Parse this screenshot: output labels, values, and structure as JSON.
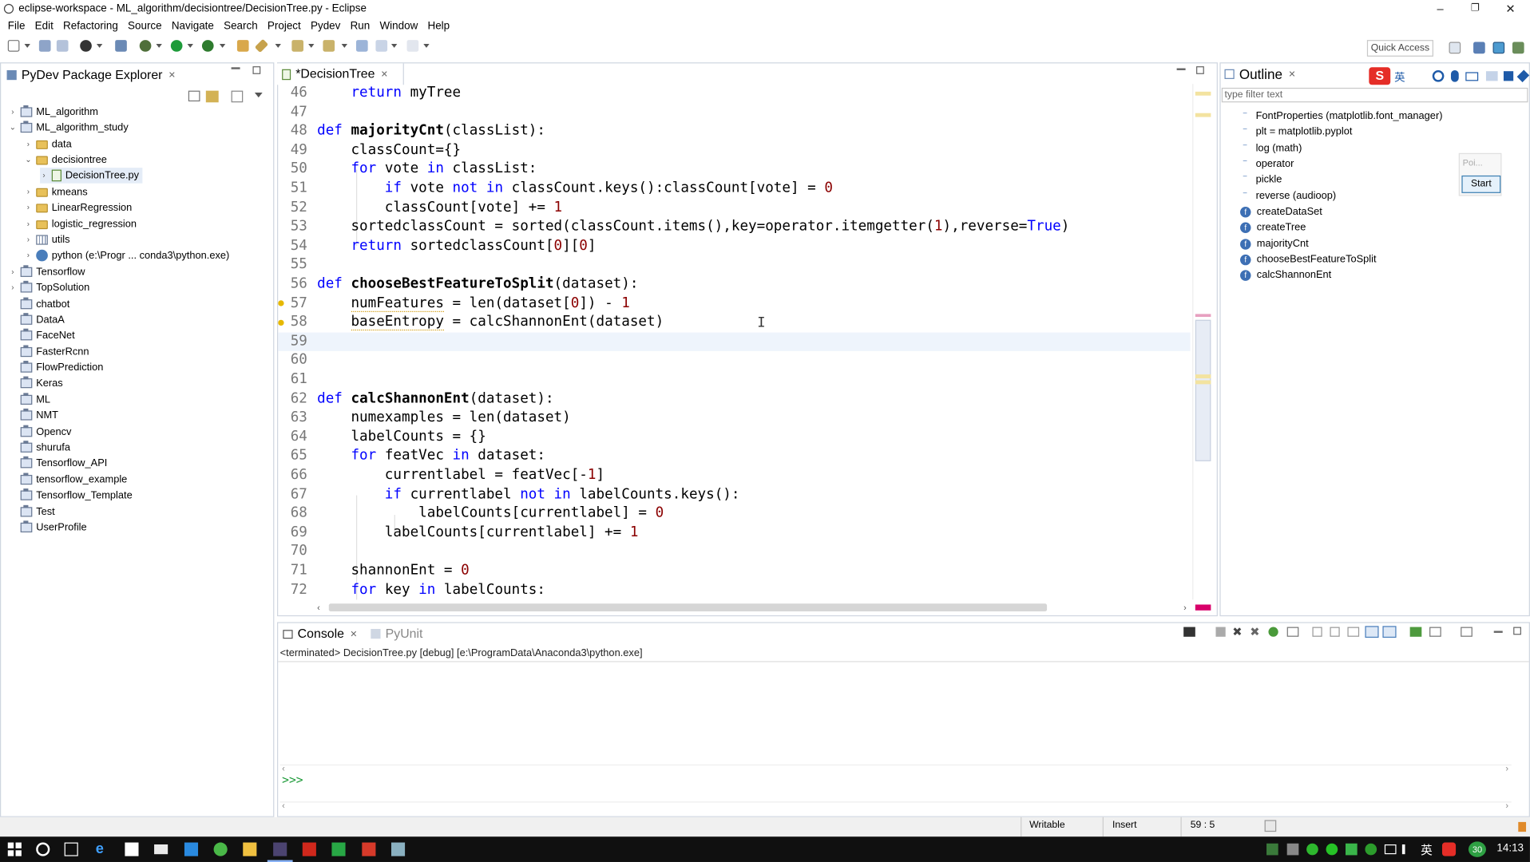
{
  "window": {
    "title": "eclipse-workspace - ML_algorithm/decisiontree/DecisionTree.py - Eclipse",
    "minimize": "–",
    "restore": "❐",
    "close": "✕"
  },
  "menu": [
    "File",
    "Edit",
    "Refactoring",
    "Source",
    "Navigate",
    "Search",
    "Project",
    "Pydev",
    "Run",
    "Window",
    "Help"
  ],
  "quick_access": "Quick Access",
  "package_explorer": {
    "title": "PyDev Package Explorer",
    "close": "✕",
    "items": [
      {
        "label": "ML_algorithm",
        "twisty": "›"
      },
      {
        "label": "ML_algorithm_study",
        "twisty": "⌄"
      },
      {
        "label": "data",
        "twisty": "›"
      },
      {
        "label": "decisiontree",
        "twisty": "⌄"
      },
      {
        "label": "DecisionTree.py",
        "twisty": "›"
      },
      {
        "label": "kmeans",
        "twisty": "›"
      },
      {
        "label": "LinearRegression",
        "twisty": "›"
      },
      {
        "label": "logistic_regression",
        "twisty": "›"
      },
      {
        "label": "utils",
        "twisty": "›"
      },
      {
        "label": "python  (e:\\Progr ... conda3\\python.exe)",
        "twisty": "›"
      },
      {
        "label": "Tensorflow",
        "twisty": "›"
      },
      {
        "label": "TopSolution",
        "twisty": "›"
      },
      {
        "label": "chatbot",
        "twisty": ""
      },
      {
        "label": "DataA",
        "twisty": ""
      },
      {
        "label": "FaceNet",
        "twisty": ""
      },
      {
        "label": "FasterRcnn",
        "twisty": ""
      },
      {
        "label": "FlowPrediction",
        "twisty": ""
      },
      {
        "label": "Keras",
        "twisty": ""
      },
      {
        "label": "ML",
        "twisty": ""
      },
      {
        "label": "NMT",
        "twisty": ""
      },
      {
        "label": "Opencv",
        "twisty": ""
      },
      {
        "label": "shurufa",
        "twisty": ""
      },
      {
        "label": "Tensorflow_API",
        "twisty": ""
      },
      {
        "label": "tensorflow_example",
        "twisty": ""
      },
      {
        "label": "Tensorflow_Template",
        "twisty": ""
      },
      {
        "label": "Test",
        "twisty": ""
      },
      {
        "label": "UserProfile",
        "twisty": ""
      }
    ]
  },
  "editor": {
    "tab": "*DecisionTree",
    "close": "✕",
    "lines": [
      {
        "n": "46",
        "code": "    return myTree"
      },
      {
        "n": "47",
        "code": ""
      },
      {
        "n": "48",
        "code": "def majorityCnt(classList):"
      },
      {
        "n": "49",
        "code": "    classCount={}"
      },
      {
        "n": "50",
        "code": "    for vote in classList:"
      },
      {
        "n": "51",
        "code": "        if vote not in classCount.keys():classCount[vote] = 0"
      },
      {
        "n": "52",
        "code": "        classCount[vote] += 1"
      },
      {
        "n": "53",
        "code": "    sortedclassCount = sorted(classCount.items(),key=operator.itemgetter(1),reverse=True)"
      },
      {
        "n": "54",
        "code": "    return sortedclassCount[0][0]"
      },
      {
        "n": "55",
        "code": ""
      },
      {
        "n": "56",
        "code": "def chooseBestFeatureToSplit(dataset):"
      },
      {
        "n": "57",
        "code": "    numFeatures = len(dataset[0]) - 1"
      },
      {
        "n": "58",
        "code": "    baseEntropy = calcShannonEnt(dataset)"
      },
      {
        "n": "59",
        "code": ""
      },
      {
        "n": "60",
        "code": ""
      },
      {
        "n": "61",
        "code": ""
      },
      {
        "n": "62",
        "code": "def calcShannonEnt(dataset):"
      },
      {
        "n": "63",
        "code": "    numexamples = len(dataset)"
      },
      {
        "n": "64",
        "code": "    labelCounts = {}"
      },
      {
        "n": "65",
        "code": "    for featVec in dataset:"
      },
      {
        "n": "66",
        "code": "        currentlabel = featVec[-1]"
      },
      {
        "n": "67",
        "code": "        if currentlabel not in labelCounts.keys():"
      },
      {
        "n": "68",
        "code": "            labelCounts[currentlabel] = 0"
      },
      {
        "n": "69",
        "code": "        labelCounts[currentlabel] += 1"
      },
      {
        "n": "70",
        "code": ""
      },
      {
        "n": "71",
        "code": "    shannonEnt = 0"
      },
      {
        "n": "72",
        "code": "    for key in labelCounts:"
      }
    ],
    "current_line": "59"
  },
  "outline": {
    "title": "Outline",
    "close": "✕",
    "filter_placeholder": "type filter text",
    "items": [
      {
        "label": "FontProperties (matplotlib.font_manager)",
        "kind": "import"
      },
      {
        "label": "plt = matplotlib.pyplot",
        "kind": "import"
      },
      {
        "label": "log (math)",
        "kind": "import"
      },
      {
        "label": "operator",
        "kind": "import"
      },
      {
        "label": "pickle",
        "kind": "import"
      },
      {
        "label": "reverse (audioop)",
        "kind": "import"
      },
      {
        "label": "createDataSet",
        "kind": "function"
      },
      {
        "label": "createTree",
        "kind": "function"
      },
      {
        "label": "majorityCnt",
        "kind": "function"
      },
      {
        "label": "chooseBestFeatureToSplit",
        "kind": "function"
      },
      {
        "label": "calcShannonEnt",
        "kind": "function"
      }
    ],
    "popup_label": "Poi...",
    "start_button": "Start",
    "ime_label": "英"
  },
  "console": {
    "tab_console": "Console",
    "tab_pyunit": "PyUnit",
    "close": "✕",
    "terminated": "<terminated> DecisionTree.py [debug] [e:\\ProgramData\\Anaconda3\\python.exe]",
    "prompt": ">>>"
  },
  "status": {
    "writable": "Writable",
    "insert": "Insert",
    "position": "59 : 5"
  },
  "taskbar": {
    "ime": "英",
    "badge": "30",
    "time": "14:13"
  },
  "colors": {
    "keyword": "#0000ff",
    "number": "#8b0000",
    "current_line": "#eef4fc",
    "taskbar": "#101010"
  }
}
